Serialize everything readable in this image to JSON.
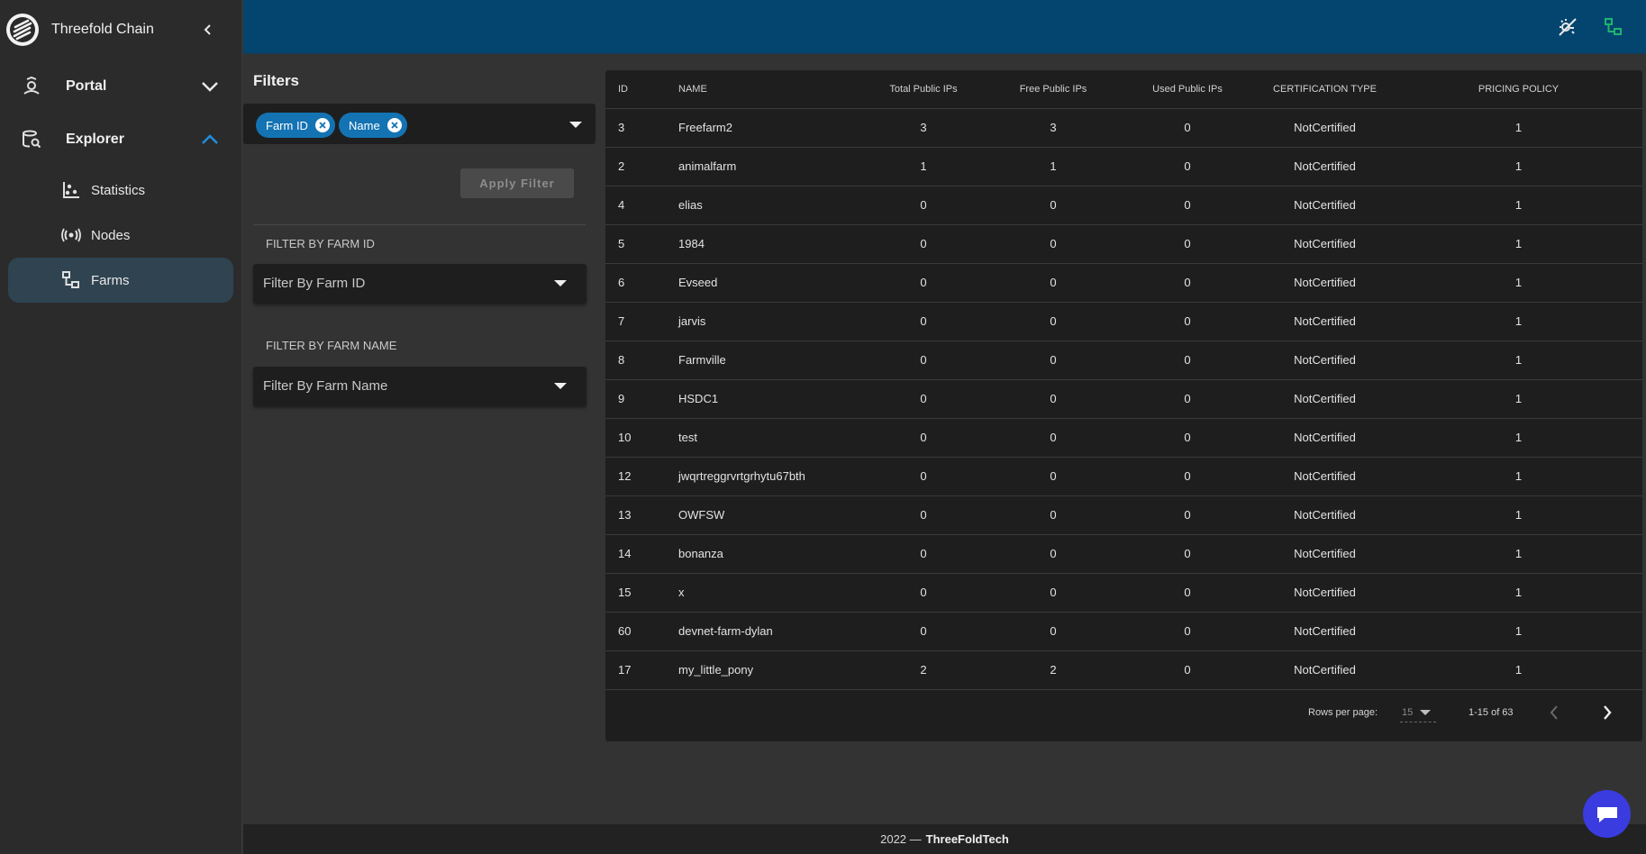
{
  "sidebar": {
    "app_title": "Threefold Chain",
    "groups": [
      {
        "label": "Portal",
        "icon": "portal-icon",
        "expanded": false
      },
      {
        "label": "Explorer",
        "icon": "explorer-icon",
        "expanded": true
      }
    ],
    "items": [
      {
        "label": "Statistics",
        "icon": "statistics-icon"
      },
      {
        "label": "Nodes",
        "icon": "nodes-icon"
      },
      {
        "label": "Farms",
        "icon": "farms-icon",
        "active": true
      }
    ]
  },
  "topbar": {
    "icons": [
      "theme-toggle-icon",
      "connection-status-icon"
    ],
    "status_color": "#1fb46e"
  },
  "filters": {
    "title": "Filters",
    "chips": [
      "Farm ID",
      "Name"
    ],
    "apply_label": "Apply Filter",
    "farm_id": {
      "label": "FILTER BY FARM ID",
      "placeholder": "Filter By Farm ID"
    },
    "farm_name": {
      "label": "FILTER BY FARM NAME",
      "placeholder": "Filter By Farm Name"
    }
  },
  "table": {
    "headers": [
      "ID",
      "NAME",
      "Total Public IPs",
      "Free Public IPs",
      "Used Public IPs",
      "CERTIFICATION TYPE",
      "PRICING POLICY"
    ],
    "rows": [
      [
        "3",
        "Freefarm2",
        "3",
        "3",
        "0",
        "NotCertified",
        "1"
      ],
      [
        "2",
        "animalfarm",
        "1",
        "1",
        "0",
        "NotCertified",
        "1"
      ],
      [
        "4",
        "elias",
        "0",
        "0",
        "0",
        "NotCertified",
        "1"
      ],
      [
        "5",
        "1984",
        "0",
        "0",
        "0",
        "NotCertified",
        "1"
      ],
      [
        "6",
        "Evseed",
        "0",
        "0",
        "0",
        "NotCertified",
        "1"
      ],
      [
        "7",
        "jarvis",
        "0",
        "0",
        "0",
        "NotCertified",
        "1"
      ],
      [
        "8",
        "Farmville",
        "0",
        "0",
        "0",
        "NotCertified",
        "1"
      ],
      [
        "9",
        "HSDC1",
        "0",
        "0",
        "0",
        "NotCertified",
        "1"
      ],
      [
        "10",
        "test",
        "0",
        "0",
        "0",
        "NotCertified",
        "1"
      ],
      [
        "12",
        "jwqrtreggrvrtgrhytu67bth",
        "0",
        "0",
        "0",
        "NotCertified",
        "1"
      ],
      [
        "13",
        "OWFSW",
        "0",
        "0",
        "0",
        "NotCertified",
        "1"
      ],
      [
        "14",
        "bonanza",
        "0",
        "0",
        "0",
        "NotCertified",
        "1"
      ],
      [
        "15",
        "x",
        "0",
        "0",
        "0",
        "NotCertified",
        "1"
      ],
      [
        "60",
        "devnet-farm-dylan",
        "0",
        "0",
        "0",
        "NotCertified",
        "1"
      ],
      [
        "17",
        "my_little_pony",
        "2",
        "2",
        "0",
        "NotCertified",
        "1"
      ]
    ],
    "pagination": {
      "rows_per_page_label": "Rows per page:",
      "rows_per_page": "15",
      "range": "1-15 of 63"
    }
  },
  "footer": {
    "year": "2022 —",
    "company": "ThreeFoldTech"
  },
  "colors": {
    "accent": "#1473b3",
    "topbar": "#044570",
    "chat": "#3a3ce0"
  }
}
